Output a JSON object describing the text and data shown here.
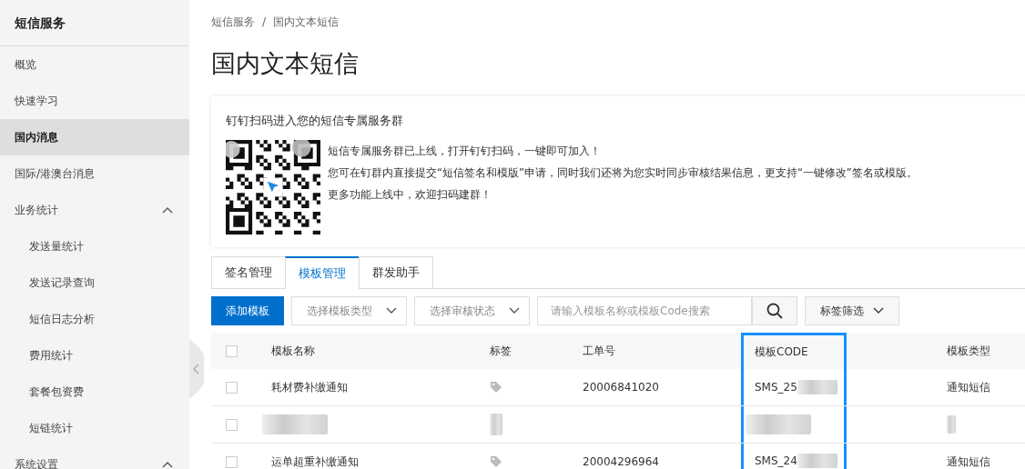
{
  "sidebar": {
    "title": "短信服务",
    "items": [
      {
        "label": "概览",
        "selected": false
      },
      {
        "label": "快速学习",
        "selected": false
      },
      {
        "label": "国内消息",
        "selected": true
      },
      {
        "label": "国际/港澳台消息",
        "selected": false
      },
      {
        "label": "业务统计",
        "selected": false,
        "expanded": true,
        "children": [
          {
            "label": "发送量统计",
            "selected": false
          },
          {
            "label": "发送记录查询",
            "selected": false
          },
          {
            "label": "短信日志分析",
            "selected": false
          },
          {
            "label": "费用统计",
            "selected": false
          },
          {
            "label": "套餐包资费",
            "selected": false
          },
          {
            "label": "短链统计",
            "selected": false
          }
        ]
      },
      {
        "label": "系统设置",
        "selected": false,
        "expanded": true
      }
    ]
  },
  "breadcrumb": [
    "短信服务",
    "国内文本短信"
  ],
  "breadcrumb_separator": "/",
  "page_title": "国内文本短信",
  "notice": {
    "title": "钉钉扫码进入您的短信专属服务群",
    "lines": [
      "短信专属服务群已上线，打开钉钉扫码，一键即可加入！",
      "您可在钉群内直接提交“短信签名和模版”申请，同时我们还将为您实时同步审核结果信息，更支持“一键修改”签名或模版。",
      "更多功能上线中，欢迎扫码建群！"
    ]
  },
  "tabs": [
    {
      "label": "签名管理",
      "selected": false
    },
    {
      "label": "模板管理",
      "selected": true
    },
    {
      "label": "群发助手",
      "selected": false
    }
  ],
  "toolbar": {
    "add_button": "添加模板",
    "type_select": {
      "placeholder": "选择模板类型"
    },
    "status_select": {
      "placeholder": "选择审核状态"
    },
    "search": {
      "placeholder": "请输入模板名称或模板Code搜索"
    },
    "tag_filter": "标签筛选"
  },
  "table": {
    "all_checked": false,
    "columns": [
      {
        "label": "模板名称",
        "highlighted": false
      },
      {
        "label": "标签",
        "highlighted": false
      },
      {
        "label": "工单号",
        "highlighted": false
      },
      {
        "label": "模板CODE",
        "highlighted": true
      },
      {
        "label": "模板类型",
        "highlighted": false
      }
    ],
    "rows": [
      {
        "kind": "row",
        "checked": false,
        "name": "耗材费补缴通知",
        "has_tag": true,
        "order": "20006841020",
        "code": "SMS_25",
        "type": "通知短信"
      },
      {
        "kind": "redacted",
        "checked": false
      },
      {
        "kind": "row",
        "checked": false,
        "name": "运单超重补缴通知",
        "has_tag": true,
        "order": "20004296964",
        "code": "SMS_24",
        "type": "通知短信"
      }
    ]
  }
}
